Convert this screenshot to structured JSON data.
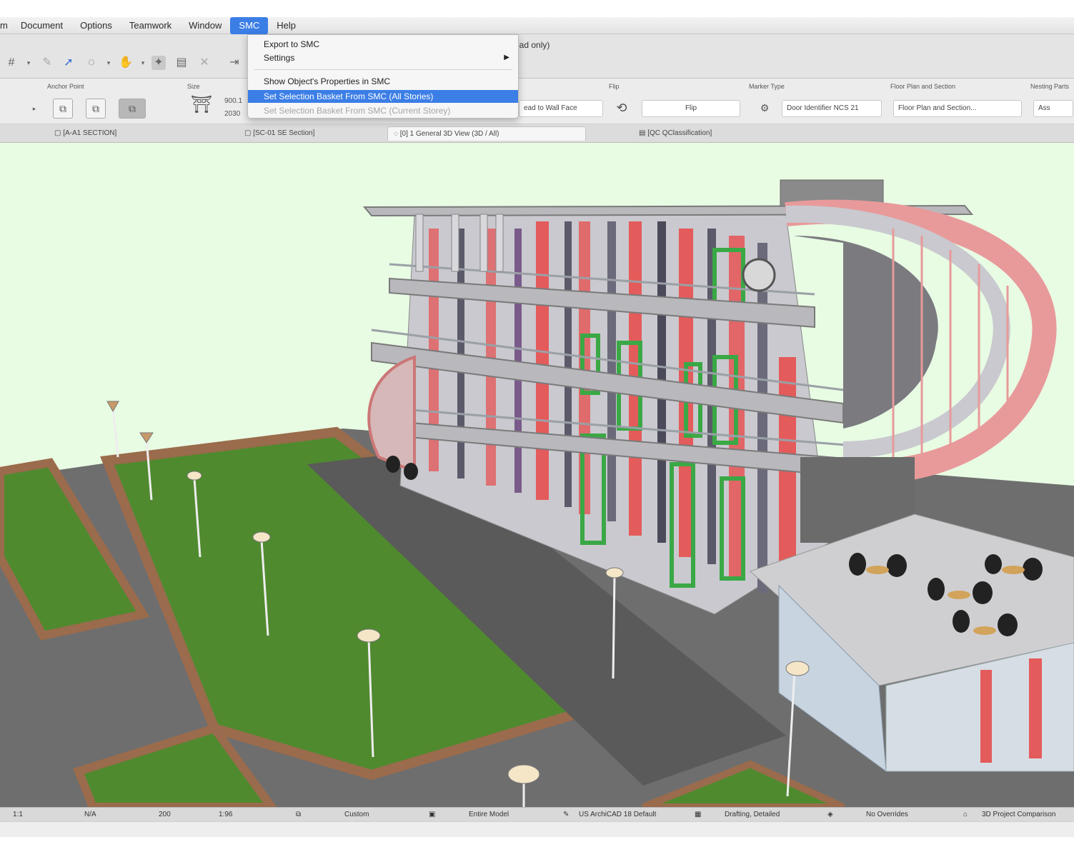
{
  "menubar": {
    "items": [
      "m",
      "Document",
      "Options",
      "Teamwork",
      "Window",
      "SMC",
      "Help"
    ],
    "active_index": 5
  },
  "toolbar": {
    "window_title_suffix": "ead only)"
  },
  "dropdown": {
    "items": [
      {
        "label": "Export to SMC",
        "state": "normal"
      },
      {
        "label": "Settings",
        "state": "normal",
        "submenu": true
      },
      {
        "label": "Show Object's Properties in SMC",
        "state": "normal"
      },
      {
        "label": "Set Selection Basket From SMC (All Stories)",
        "state": "highlighted"
      },
      {
        "label": "Set Selection Basket From SMC (Current Storey)",
        "state": "disabled"
      }
    ]
  },
  "infobox": {
    "labels": {
      "anchor": "Anchor Point",
      "size": "Size",
      "flip": "Flip",
      "marker": "Marker Type",
      "floorplan": "Floor Plan and Section",
      "nesting": "Nesting Parts"
    },
    "size_values": [
      "900.1",
      "2030"
    ],
    "reveal_field": "ead to Wall Face",
    "flip_field": "Flip",
    "marker_field": "Door Identifier NCS 21",
    "floorplan_field": "Floor Plan and Section...",
    "nesting_field": "Ass"
  },
  "tabs": [
    {
      "label": "[A-A1 SECTION]",
      "active": false
    },
    {
      "label": "[SC-01 SE Section]",
      "active": false
    },
    {
      "label": "[0] 1 General 3D View (3D / All)",
      "active": true
    },
    {
      "label": "[QC QClassification]",
      "active": false
    }
  ],
  "statusbar": {
    "items": [
      "1:1",
      "N/A",
      "200",
      "1:96",
      "Custom",
      "Entire Model",
      "US ArchiCAD 18 Default",
      "Drafting, Detailed",
      "No Overrides",
      "3D Project Comparison"
    ]
  },
  "colors": {
    "sky": "#e8fbe3",
    "menu_highlight": "#3b7ee6",
    "grass": "#4f8a2f",
    "path": "#5a5a5a",
    "brick": "#9a6b4c",
    "facade_red": "#e45b5b"
  }
}
